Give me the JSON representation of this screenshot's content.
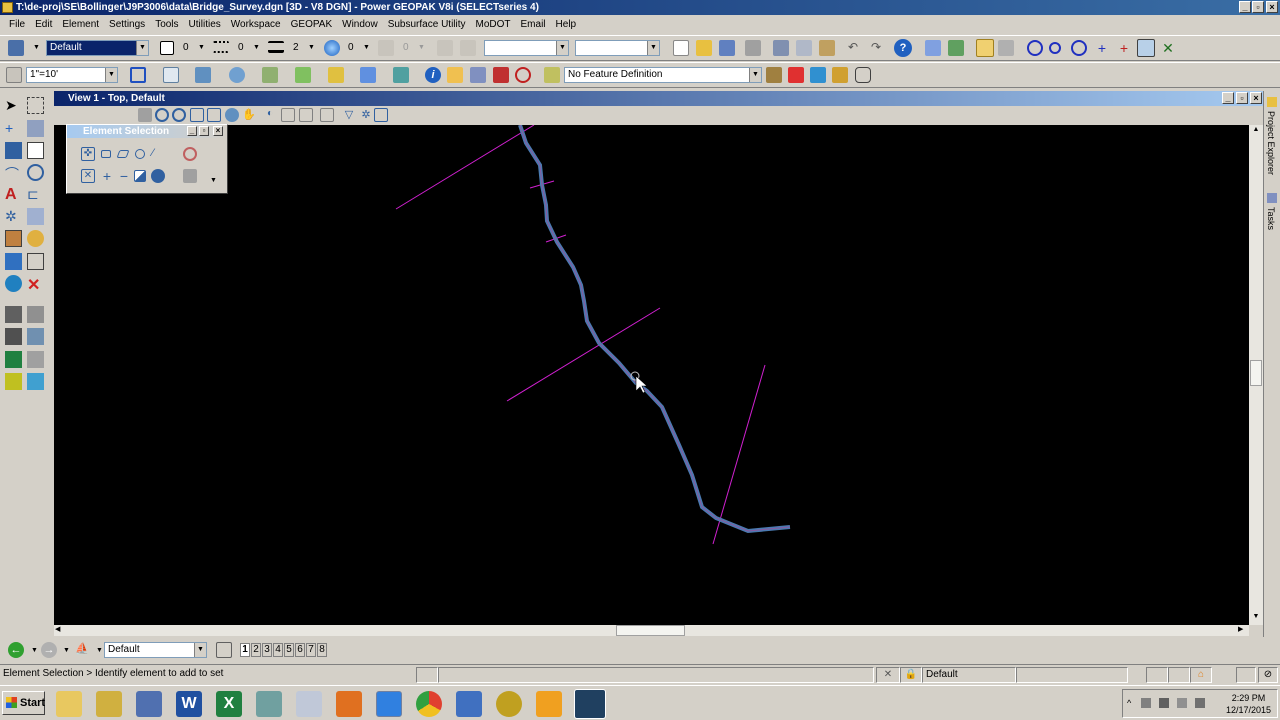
{
  "window": {
    "title": "T:\\de-proj\\SE\\Bollinger\\J9P3006\\data\\Bridge_Survey.dgn [3D - V8 DGN] - Power GEOPAK V8i (SELECTseries 4)"
  },
  "menu": [
    "File",
    "Edit",
    "Element",
    "Settings",
    "Tools",
    "Utilities",
    "Workspace",
    "GEOPAK",
    "Window",
    "Subsurface Utility",
    "MoDOT",
    "Email",
    "Help"
  ],
  "attributes_toolbar": {
    "level": "Default",
    "color": "0",
    "style": "0",
    "weight": "2",
    "transparency": "0",
    "priority": "0"
  },
  "second_toolbar": {
    "scale": "1\"=10'",
    "feature_definition": "No Feature Definition"
  },
  "view": {
    "title": "View 1 - Top, Default"
  },
  "element_selection": {
    "title": "Element Selection"
  },
  "right_panel": {
    "project_explorer": "Project Explorer",
    "tasks": "Tasks"
  },
  "viewbar": {
    "level": "Default",
    "view_numbers": [
      "1",
      "2",
      "3",
      "4",
      "5",
      "6",
      "7",
      "8"
    ]
  },
  "status": {
    "prompt": "Element Selection > Identify element to add to set",
    "level": "Default"
  },
  "taskbar": {
    "start": "Start",
    "time": "2:29 PM",
    "date": "12/17/2015"
  },
  "colors": {
    "alignment": "#4a7ab0",
    "cross_sections": "#d020d0",
    "canvas": "#000000"
  }
}
